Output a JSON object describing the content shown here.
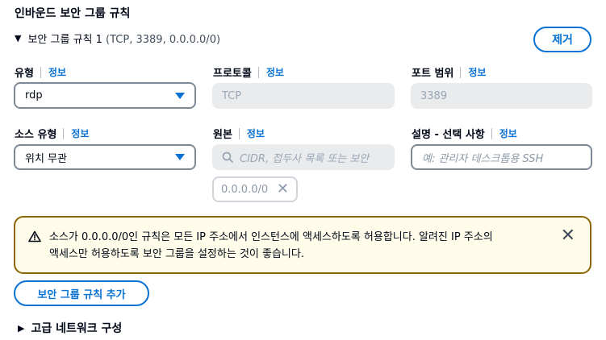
{
  "section": {
    "title": "인바운드 보안 그룹 규칙"
  },
  "rule": {
    "title": "보안 그룹 규칙 1",
    "summary": "(TCP, 3389, 0.0.0.0/0)",
    "remove_label": "제거"
  },
  "fields": {
    "type": {
      "label": "유형",
      "info": "정보",
      "value": "rdp"
    },
    "protocol": {
      "label": "프로토콜",
      "info": "정보",
      "value": "TCP"
    },
    "port_range": {
      "label": "포트 범위",
      "info": "정보",
      "value": "3389"
    },
    "source_type": {
      "label": "소스 유형",
      "info": "정보",
      "value": "위치 무관"
    },
    "source": {
      "label": "원본",
      "info": "정보",
      "placeholder": "CIDR, 접두사 목록 또는 보안",
      "token": "0.0.0.0/0"
    },
    "description": {
      "label": "설명 - 선택 사항",
      "info": "정보",
      "placeholder": "예: 관리자 데스크톱용 SSH"
    }
  },
  "alert": {
    "line1": "소스가 0.0.0.0/0인 규칙은 모든 IP 주소에서 인스턴스에 액세스하도록 허용합니다. 알려진 IP 주소의",
    "line2": "액세스만 허용하도록 보안 그룹을 설정하는 것이 좋습니다."
  },
  "actions": {
    "add_rule": "보안 그룹 규칙 추가"
  },
  "advanced": {
    "label": "고급 네트워크 구성"
  },
  "colors": {
    "accent": "#0972d3",
    "warning_border": "#8d6605",
    "warning_bg": "#fffce9"
  }
}
